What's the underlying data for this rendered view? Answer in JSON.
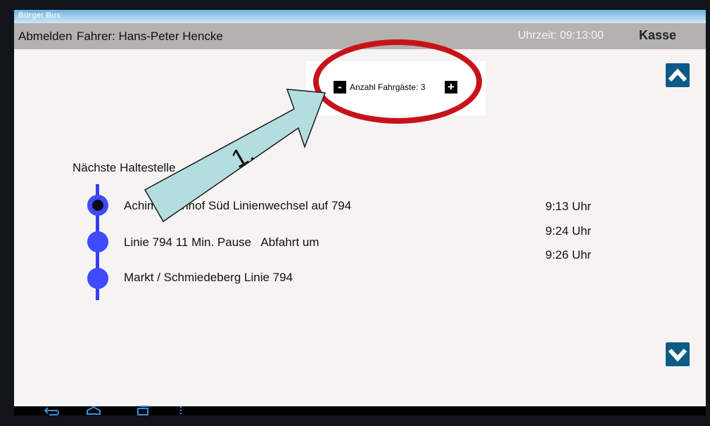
{
  "window": {
    "title": "Bürger Bus"
  },
  "header": {
    "logout_label": "Abmelden",
    "driver_label": "Fahrer: Hans-Peter Hencke",
    "time_label": "Uhrzeit: 09:13:00",
    "cash_label": "Kasse"
  },
  "passengers": {
    "minus_label": "-",
    "label": "Anzahl Fahrgäste: 3",
    "plus_label": "+"
  },
  "annotation": {
    "step_label": "1."
  },
  "stops_section": {
    "heading": "Nächste Haltestelle",
    "stops": [
      {
        "name": "Achim Bahnhof Süd Linienwechsel auf 794",
        "current": true
      },
      {
        "name": "Linie 794 11 Min. Pause   Abfahrt um",
        "current": false
      },
      {
        "name": "Markt / Schmiedeberg Linie 794",
        "current": false
      }
    ],
    "times": [
      "9:13 Uhr",
      "9:24 Uhr",
      "9:26 Uhr"
    ]
  },
  "icons": {
    "scroll_up": "chevron-up-icon",
    "scroll_down": "chevron-down-icon",
    "nav_back": "back-icon",
    "nav_home": "home-icon",
    "nav_recents": "recent-apps-icon",
    "nav_menu": "menu-icon"
  },
  "colors": {
    "titlebar": "#a8d1ee",
    "header": "#b4b2af",
    "route": "#3f4bff",
    "annotation_ellipse": "#c8121a",
    "annotation_arrow": "#b4dde0",
    "scroll_button": "#0d5a86"
  }
}
